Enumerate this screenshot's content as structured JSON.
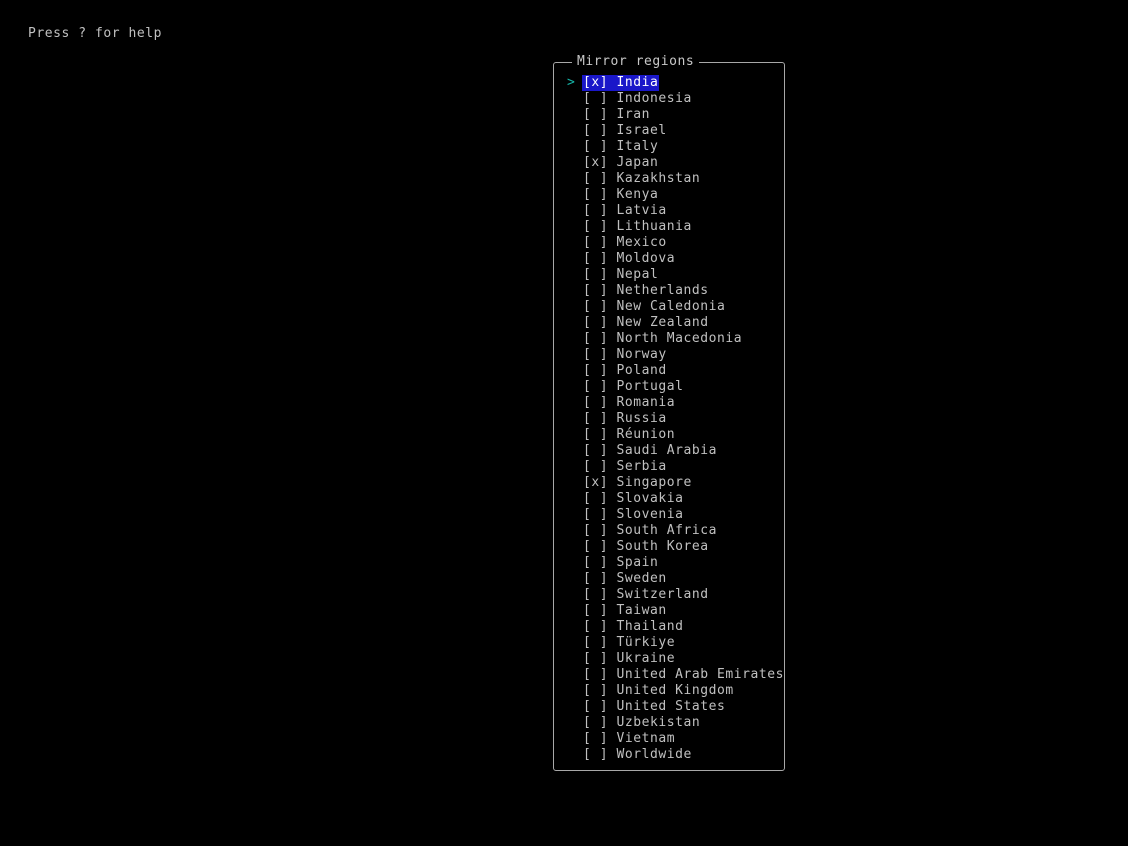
{
  "terminal": {
    "background_color": "#000000",
    "foreground_color": "#c0c0c0",
    "help_hint": "Press ? for help"
  },
  "panel": {
    "title": "Mirror regions",
    "border_color": "#a8a8a8",
    "cursor_glyph": ">",
    "cursor_color": "#16b5a8",
    "selection_background": "#1a17c9",
    "selection_foreground": "#ffffff",
    "checked_marker": "[x]",
    "unchecked_marker": "[ ]",
    "items": [
      {
        "label": "India",
        "checked": true,
        "marker": "[x]",
        "active": true
      },
      {
        "label": "Indonesia",
        "checked": false,
        "marker": "[ ]",
        "active": false
      },
      {
        "label": "Iran",
        "checked": false,
        "marker": "[ ]",
        "active": false
      },
      {
        "label": "Israel",
        "checked": false,
        "marker": "[ ]",
        "active": false
      },
      {
        "label": "Italy",
        "checked": false,
        "marker": "[ ]",
        "active": false
      },
      {
        "label": "Japan",
        "checked": true,
        "marker": "[x]",
        "active": false
      },
      {
        "label": "Kazakhstan",
        "checked": false,
        "marker": "[ ]",
        "active": false
      },
      {
        "label": "Kenya",
        "checked": false,
        "marker": "[ ]",
        "active": false
      },
      {
        "label": "Latvia",
        "checked": false,
        "marker": "[ ]",
        "active": false
      },
      {
        "label": "Lithuania",
        "checked": false,
        "marker": "[ ]",
        "active": false
      },
      {
        "label": "Mexico",
        "checked": false,
        "marker": "[ ]",
        "active": false
      },
      {
        "label": "Moldova",
        "checked": false,
        "marker": "[ ]",
        "active": false
      },
      {
        "label": "Nepal",
        "checked": false,
        "marker": "[ ]",
        "active": false
      },
      {
        "label": "Netherlands",
        "checked": false,
        "marker": "[ ]",
        "active": false
      },
      {
        "label": "New Caledonia",
        "checked": false,
        "marker": "[ ]",
        "active": false
      },
      {
        "label": "New Zealand",
        "checked": false,
        "marker": "[ ]",
        "active": false
      },
      {
        "label": "North Macedonia",
        "checked": false,
        "marker": "[ ]",
        "active": false
      },
      {
        "label": "Norway",
        "checked": false,
        "marker": "[ ]",
        "active": false
      },
      {
        "label": "Poland",
        "checked": false,
        "marker": "[ ]",
        "active": false
      },
      {
        "label": "Portugal",
        "checked": false,
        "marker": "[ ]",
        "active": false
      },
      {
        "label": "Romania",
        "checked": false,
        "marker": "[ ]",
        "active": false
      },
      {
        "label": "Russia",
        "checked": false,
        "marker": "[ ]",
        "active": false
      },
      {
        "label": "Réunion",
        "checked": false,
        "marker": "[ ]",
        "active": false
      },
      {
        "label": "Saudi Arabia",
        "checked": false,
        "marker": "[ ]",
        "active": false
      },
      {
        "label": "Serbia",
        "checked": false,
        "marker": "[ ]",
        "active": false
      },
      {
        "label": "Singapore",
        "checked": true,
        "marker": "[x]",
        "active": false
      },
      {
        "label": "Slovakia",
        "checked": false,
        "marker": "[ ]",
        "active": false
      },
      {
        "label": "Slovenia",
        "checked": false,
        "marker": "[ ]",
        "active": false
      },
      {
        "label": "South Africa",
        "checked": false,
        "marker": "[ ]",
        "active": false
      },
      {
        "label": "South Korea",
        "checked": false,
        "marker": "[ ]",
        "active": false
      },
      {
        "label": "Spain",
        "checked": false,
        "marker": "[ ]",
        "active": false
      },
      {
        "label": "Sweden",
        "checked": false,
        "marker": "[ ]",
        "active": false
      },
      {
        "label": "Switzerland",
        "checked": false,
        "marker": "[ ]",
        "active": false
      },
      {
        "label": "Taiwan",
        "checked": false,
        "marker": "[ ]",
        "active": false
      },
      {
        "label": "Thailand",
        "checked": false,
        "marker": "[ ]",
        "active": false
      },
      {
        "label": "Türkiye",
        "checked": false,
        "marker": "[ ]",
        "active": false
      },
      {
        "label": "Ukraine",
        "checked": false,
        "marker": "[ ]",
        "active": false
      },
      {
        "label": "United Arab Emirates",
        "checked": false,
        "marker": "[ ]",
        "active": false
      },
      {
        "label": "United Kingdom",
        "checked": false,
        "marker": "[ ]",
        "active": false
      },
      {
        "label": "United States",
        "checked": false,
        "marker": "[ ]",
        "active": false
      },
      {
        "label": "Uzbekistan",
        "checked": false,
        "marker": "[ ]",
        "active": false
      },
      {
        "label": "Vietnam",
        "checked": false,
        "marker": "[ ]",
        "active": false
      },
      {
        "label": "Worldwide",
        "checked": false,
        "marker": "[ ]",
        "active": false
      }
    ]
  }
}
